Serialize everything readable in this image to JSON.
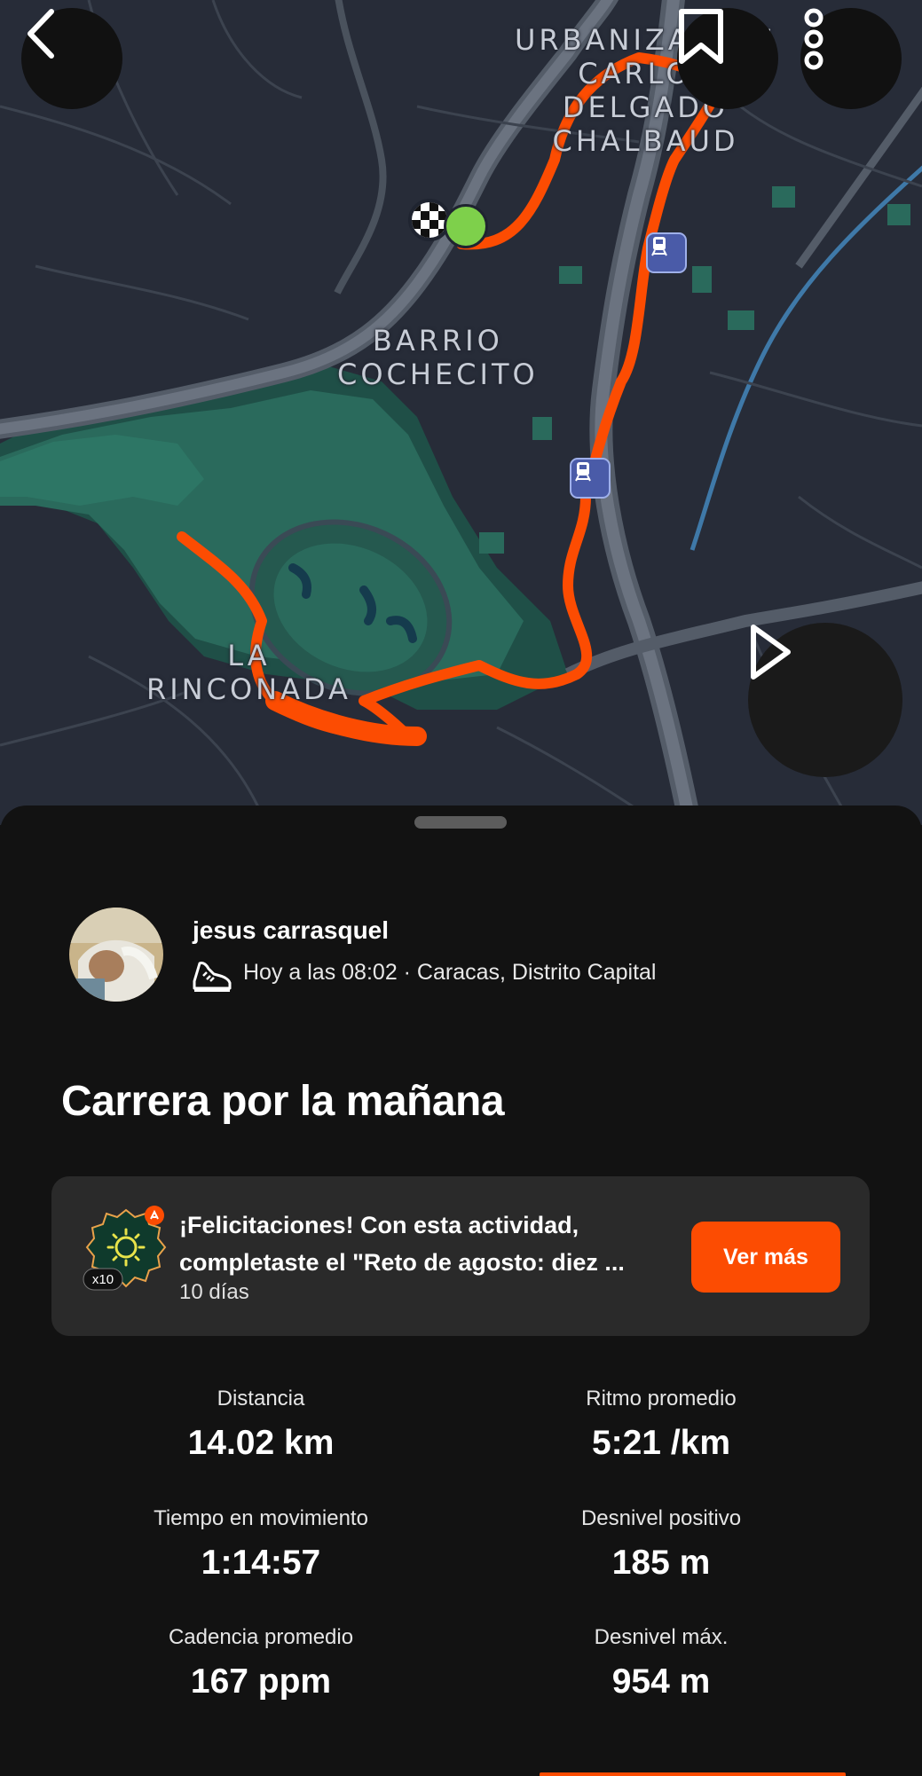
{
  "map": {
    "labels": {
      "urbanizacion": "URBANIZACIÓN\nCARLOS\nDELGADO\nCHALBAUD",
      "barrio": "BARRIO\nCOCHECITO",
      "rinconada": "LA\nRINCONADA"
    },
    "route_color": "#fc4c02"
  },
  "header": {
    "back_icon": "chevron-left-icon",
    "bookmark_icon": "bookmark-icon",
    "more_icon": "more-vertical-icon",
    "play_icon": "play-icon"
  },
  "athlete": {
    "name": "jesus carrasquel",
    "meta": "Hoy a las 08:02 · Caracas, Distrito Capital",
    "activity_icon": "running-shoe-icon"
  },
  "activity": {
    "title": "Carrera por la mañana"
  },
  "challenge": {
    "line1": "¡Felicitaciones! Con esta actividad,",
    "line2": "completaste el \"Reto de agosto: diez ...",
    "subtitle": "10 días",
    "badge_count": "x10",
    "button_label": "Ver más",
    "accent": "#fc4c02"
  },
  "stats": [
    {
      "label": "Distancia",
      "value": "14.02 km"
    },
    {
      "label": "Ritmo promedio",
      "value": "5:21 /km"
    },
    {
      "label": "Tiempo en movimiento",
      "value": "1:14:57"
    },
    {
      "label": "Desnivel positivo",
      "value": "185 m"
    },
    {
      "label": "Cadencia promedio",
      "value": "167 ppm"
    },
    {
      "label": "Desnivel máx.",
      "value": "954 m"
    }
  ]
}
